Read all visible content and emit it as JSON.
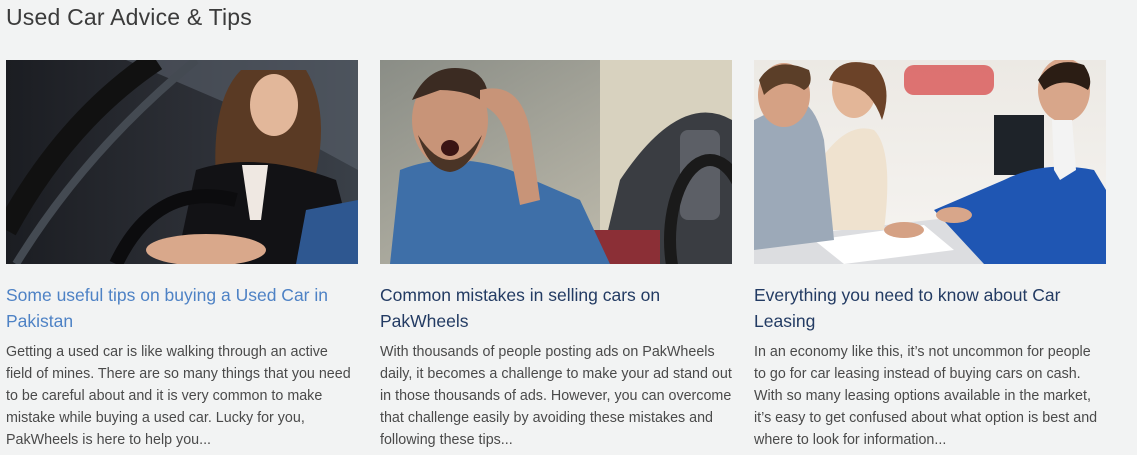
{
  "section": {
    "title": "Used Car Advice & Tips"
  },
  "cards": [
    {
      "title": "Some useful tips on buying a Used Car in Pakistan",
      "excerpt": "Getting a used car is like walking through an active field of mines. There are so many things that you need to be careful about and it is very common to make mistake while buying a used car. Lucky for you, PakWheels is here to help you...",
      "title_color": "#4e82c5"
    },
    {
      "title": "Common mistakes in selling cars on PakWheels",
      "excerpt": "With thousands of people posting ads on PakWheels daily, it becomes a challenge to make your ad stand out in those thousands of ads. However, you can overcome that challenge easily by avoiding these mistakes and following these tips...",
      "title_color": "#233b63"
    },
    {
      "title": "Everything you need to know about Car Leasing",
      "excerpt": "In an economy like this, it’s not uncommon for people to go for car leasing instead of buying cars on cash. With so many leasing options available in the market, it’s easy to get confused about what option is best and where to look for information...",
      "title_color": "#233b63"
    }
  ]
}
